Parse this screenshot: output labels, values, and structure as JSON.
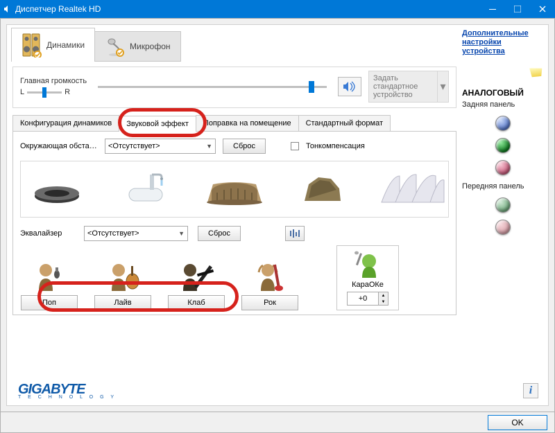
{
  "window": {
    "title": "Диспетчер Realtek HD"
  },
  "device_tabs": [
    {
      "label": "Динамики",
      "active": true
    },
    {
      "label": "Микрофон",
      "active": false
    }
  ],
  "sidepanel": {
    "advanced_link": "Дополнительные настройки устройства",
    "analog_title": "АНАЛОГОВЫЙ",
    "rear_label": "Задняя панель",
    "front_label": "Передняя панель",
    "jacks": {
      "rear": [
        "#6f8fe0",
        "#2aab3b",
        "#e48aa0"
      ],
      "front": [
        "#7fb58d",
        "#e8b6bd"
      ]
    }
  },
  "volume": {
    "title": "Главная громкость",
    "left": "L",
    "right": "R",
    "default_device": "Задать стандартное устройство"
  },
  "subtabs": [
    {
      "label": "Конфигурация динамиков"
    },
    {
      "label": "Звуковой эффект",
      "active": true
    },
    {
      "label": "Поправка на помещение"
    },
    {
      "label": "Стандартный формат"
    }
  ],
  "effect": {
    "env_label": "Окружающая обста…",
    "env_value": "<Отсутствует>",
    "reset": "Сброс",
    "tonecomp": "Тонкомпенсация",
    "eq_label": "Эквалайзер",
    "eq_value": "<Отсутствует>",
    "presets": [
      "Поп",
      "Лайв",
      "Клаб",
      "Рок"
    ],
    "karaoke_label": "КараОКе",
    "karaoke_value": "+0"
  },
  "brand": {
    "name": "GIGABYTE",
    "tag": "T E C H N O L O G Y"
  },
  "ok": "OK"
}
